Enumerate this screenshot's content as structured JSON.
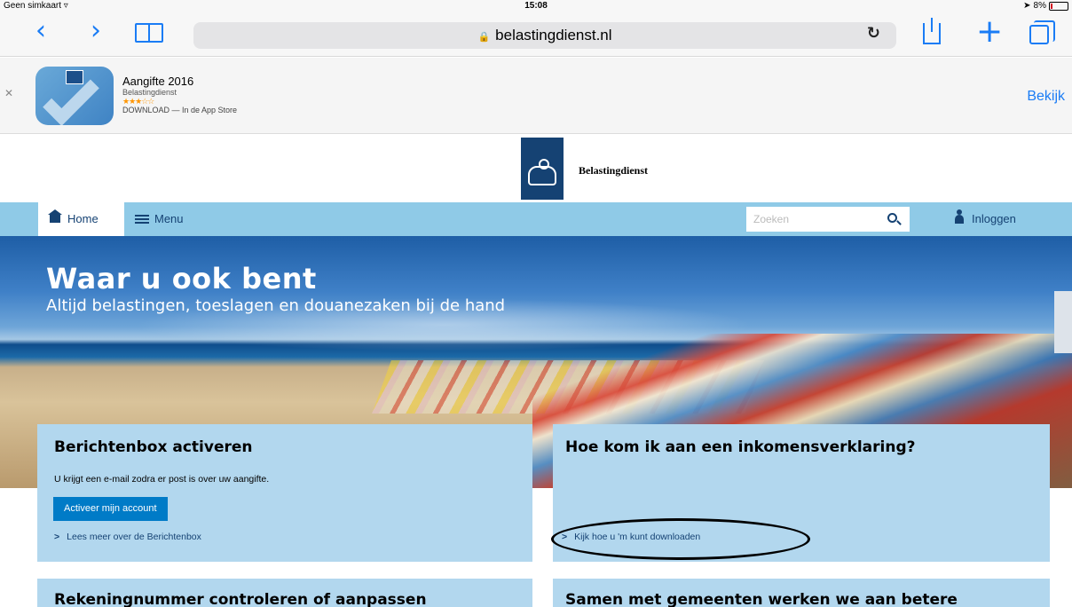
{
  "status_bar": {
    "carrier": "Geen simkaart ▿",
    "time": "15:08",
    "battery": "8%"
  },
  "browser": {
    "url": "belastingdienst.nl"
  },
  "app_banner": {
    "app_name": "Aangifte 2016",
    "publisher": "Belastingdienst",
    "stars": "★★★☆☆",
    "download_text": "DOWNLOAD — In de App Store",
    "action_label": "Bekijk"
  },
  "site": {
    "logo_text": "Belastingdienst"
  },
  "nav": {
    "home_label": "Home",
    "menu_label": "Menu",
    "search_placeholder": "Zoeken",
    "login_label": "Inloggen"
  },
  "hero": {
    "title": "Waar u ook bent",
    "subtitle": "Altijd belastingen, toeslagen en douanezaken bij de hand"
  },
  "cards": [
    {
      "title": "Berichtenbox activeren",
      "text": "U krijgt een e-mail zodra er post is over uw aangifte.",
      "button": "Activeer mijn account",
      "link": "Lees meer over de Berichtenbox"
    },
    {
      "title": "Hoe kom ik aan een inkomensverklaring?",
      "link": "Kijk hoe u 'm kunt downloaden"
    },
    {
      "title": "Rekeningnummer controleren of aanpassen"
    },
    {
      "title": "Samen met gemeenten werken we aan betere"
    }
  ],
  "colors": {
    "brand_dark_blue": "#154273",
    "nav_light_blue": "#8fcae7",
    "card_blue": "#b2d7ee",
    "button_blue": "#007bc7",
    "ios_link_blue": "#1a7cf5"
  }
}
